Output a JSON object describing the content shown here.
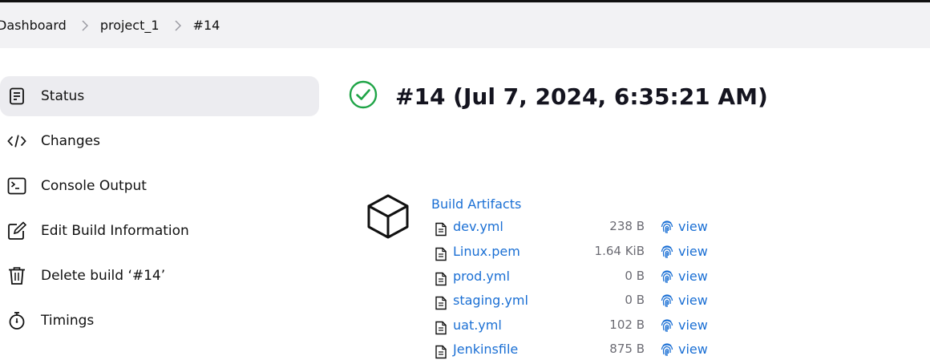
{
  "breadcrumb": {
    "items": [
      "Dashboard",
      "project_1",
      "#14"
    ]
  },
  "sidebar": {
    "items": [
      {
        "label": "Status",
        "icon": "status-doc-icon",
        "active": true
      },
      {
        "label": "Changes",
        "icon": "code-icon"
      },
      {
        "label": "Console Output",
        "icon": "terminal-icon"
      },
      {
        "label": "Edit Build Information",
        "icon": "edit-icon"
      },
      {
        "label": "Delete build ‘#14’",
        "icon": "trash-icon"
      },
      {
        "label": "Timings",
        "icon": "stopwatch-icon"
      }
    ]
  },
  "build": {
    "title": "#14 (Jul 7, 2024, 6:35:21 AM)",
    "status_icon": "success-check-icon",
    "status_color": "#1ea446"
  },
  "artifacts": {
    "heading": "Build Artifacts",
    "icon": "package-cube-icon",
    "view_label": "view",
    "files": [
      {
        "name": "dev.yml",
        "size": "238 B"
      },
      {
        "name": "Linux.pem",
        "size": "1.64 KiB"
      },
      {
        "name": "prod.yml",
        "size": "0 B"
      },
      {
        "name": "staging.yml",
        "size": "0 B"
      },
      {
        "name": "uat.yml",
        "size": "102 B"
      },
      {
        "name": "Jenkinsfile",
        "size": "875 B"
      }
    ]
  },
  "colors": {
    "link": "#1a6fd4",
    "success": "#1ea446",
    "breadcrumb_bg": "#f2f2f4",
    "active_item_bg": "#ececf0"
  }
}
